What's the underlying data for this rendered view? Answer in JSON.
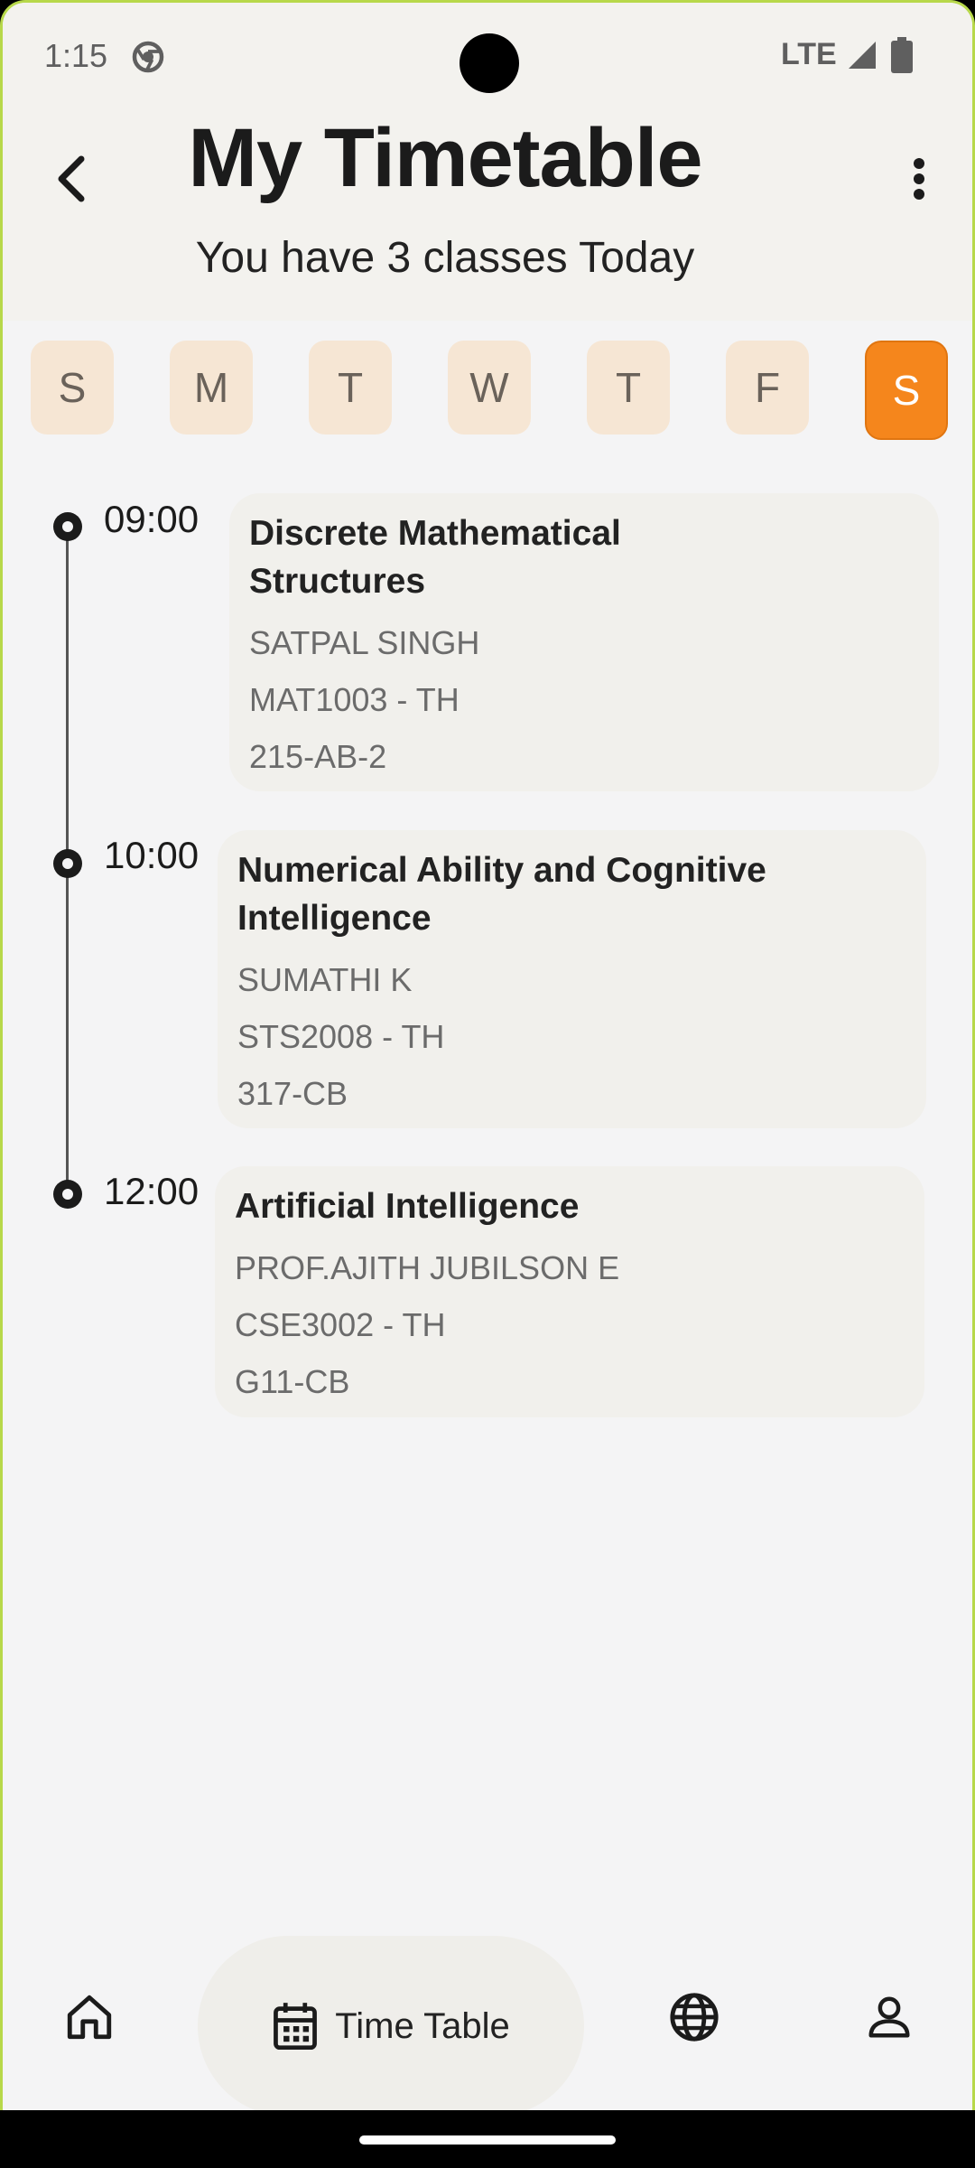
{
  "status_bar": {
    "time": "1:15",
    "network": "LTE"
  },
  "header": {
    "title": "My Timetable",
    "subtitle": "You have 3 classes Today"
  },
  "days": [
    {
      "label": "S",
      "active": false
    },
    {
      "label": "M",
      "active": false
    },
    {
      "label": "T",
      "active": false
    },
    {
      "label": "W",
      "active": false
    },
    {
      "label": "T",
      "active": false
    },
    {
      "label": "F",
      "active": false
    },
    {
      "label": "S",
      "active": true
    }
  ],
  "classes": [
    {
      "time": "09:00",
      "title_line1": "Discrete Mathematical",
      "title_line2": "Structures",
      "faculty": "SATPAL SINGH",
      "code": "MAT1003 - TH",
      "room": "215-AB-2"
    },
    {
      "time": "10:00",
      "title_line1": "Numerical Ability and Cognitive",
      "title_line2": "Intelligence",
      "faculty": "SUMATHI K",
      "code": "STS2008 - TH",
      "room": "317-CB"
    },
    {
      "time": "12:00",
      "title_line1": "Artificial Intelligence",
      "title_line2": "",
      "faculty": "PROF.AJITH JUBILSON E",
      "code": "CSE3002 - TH",
      "room": "G11-CB"
    }
  ],
  "nav": {
    "timetable_label": "Time Table"
  },
  "colors": {
    "accent": "#f5861c",
    "day_bg": "#f6e6d4",
    "card_bg": "#f1f0ec"
  },
  "icons": {
    "back": "chevron-left-icon",
    "menu": "more-vert-icon",
    "home": "home-icon",
    "timetable": "calendar-icon",
    "web": "globe-icon",
    "profile": "person-icon"
  }
}
